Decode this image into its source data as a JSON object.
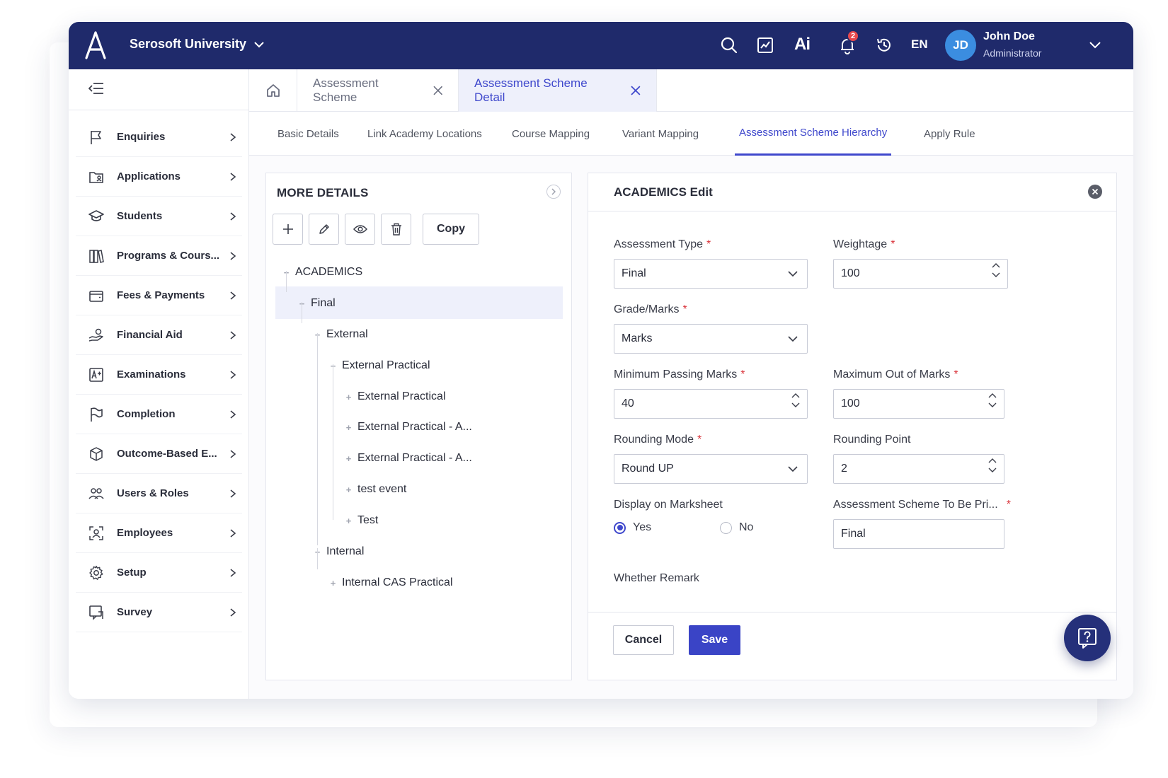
{
  "topbar": {
    "org_name": "Serosoft University",
    "ai_label": "Ai",
    "notification_count": "2",
    "language": "EN",
    "user_initials": "JD",
    "user_name": "John Doe",
    "user_role": "Administrator",
    "bg_color": "#1f2a6b"
  },
  "sidebar": {
    "items": [
      {
        "label": "Enquiries",
        "icon": "flag-icon"
      },
      {
        "label": "Applications",
        "icon": "folder-user-icon"
      },
      {
        "label": "Students",
        "icon": "graduation-cap-icon"
      },
      {
        "label": "Programs & Cours...",
        "icon": "books-icon"
      },
      {
        "label": "Fees & Payments",
        "icon": "wallet-icon"
      },
      {
        "label": "Financial Aid",
        "icon": "hand-coins-icon"
      },
      {
        "label": "Examinations",
        "icon": "grade-a-plus-icon"
      },
      {
        "label": "Completion",
        "icon": "finish-flag-icon"
      },
      {
        "label": "Outcome-Based E...",
        "icon": "cube-icon"
      },
      {
        "label": "Users & Roles",
        "icon": "users-icon"
      },
      {
        "label": "Employees",
        "icon": "employee-scan-icon"
      },
      {
        "label": "Setup",
        "icon": "gear-icon"
      },
      {
        "label": "Survey",
        "icon": "survey-icon"
      }
    ]
  },
  "doc_tabs": [
    {
      "label": "Assessment Scheme",
      "active": false
    },
    {
      "label": "Assessment Scheme Detail",
      "active": true
    }
  ],
  "sub_tabs": [
    {
      "label": "Basic Details"
    },
    {
      "label": "Link Academy Locations"
    },
    {
      "label": "Course Mapping"
    },
    {
      "label": "Variant Mapping"
    },
    {
      "label": "Assessment Scheme Hierarchy"
    },
    {
      "label": "Apply Rule"
    }
  ],
  "tree_panel": {
    "title": "MORE DETAILS",
    "copy_label": "Copy",
    "nodes": [
      {
        "label": "ACADEMICS",
        "toggle": "−"
      },
      {
        "label": "Final",
        "toggle": "−"
      },
      {
        "label": "External",
        "toggle": "−"
      },
      {
        "label": "External Practical",
        "toggle": "−"
      },
      {
        "label": "External Practical",
        "toggle": "+"
      },
      {
        "label": "External Practical - A...",
        "toggle": "+"
      },
      {
        "label": "External Practical - A...",
        "toggle": "+"
      },
      {
        "label": "test event",
        "toggle": "+"
      },
      {
        "label": "Test",
        "toggle": "+"
      },
      {
        "label": "Internal",
        "toggle": "−"
      },
      {
        "label": "Internal CAS Practical",
        "toggle": "+"
      }
    ]
  },
  "edit_panel": {
    "title": "ACADEMICS Edit",
    "fields": {
      "assessment_type": {
        "label": "Assessment Type",
        "value": "Final"
      },
      "weightage": {
        "label": "Weightage",
        "value": "100"
      },
      "grade_marks": {
        "label": "Grade/Marks",
        "value": "Marks"
      },
      "min_passing": {
        "label": "Minimum Passing Marks",
        "value": "40"
      },
      "max_out_of": {
        "label": "Maximum Out of Marks",
        "value": "100"
      },
      "rounding_mode": {
        "label": "Rounding Mode",
        "value": "Round UP"
      },
      "rounding_point": {
        "label": "Rounding Point",
        "value": "2"
      },
      "display_marksheet": {
        "label": "Display on Marksheet",
        "yes": "Yes",
        "no": "No",
        "selected": "Yes"
      },
      "scheme_to_print": {
        "label": "Assessment Scheme To Be Pri...",
        "value": "Final"
      },
      "whether_remark": {
        "label": "Whether Remark"
      }
    },
    "cancel_label": "Cancel",
    "save_label": "Save",
    "required_mark": "*"
  },
  "colors": {
    "accent": "#3f48cc",
    "required": "#d9333a"
  }
}
